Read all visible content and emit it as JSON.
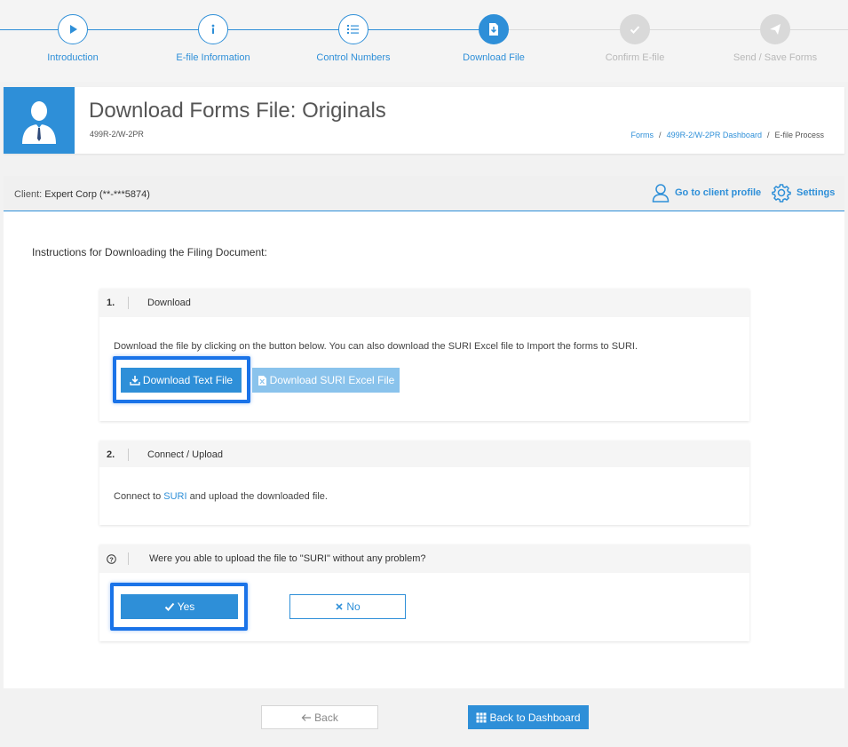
{
  "stepper": {
    "steps": [
      {
        "label": "Introduction",
        "icon": "play-icon",
        "state": "done"
      },
      {
        "label": "E-file Information",
        "icon": "info-icon",
        "state": "done"
      },
      {
        "label": "Control Numbers",
        "icon": "list-icon",
        "state": "done"
      },
      {
        "label": "Download File",
        "icon": "download-file-icon",
        "state": "current"
      },
      {
        "label": "Confirm E-file",
        "icon": "check-icon",
        "state": "todo"
      },
      {
        "label": "Send / Save Forms",
        "icon": "send-icon",
        "state": "todo"
      }
    ]
  },
  "header": {
    "title": "Download Forms File: Originals",
    "subtitle": "499R-2/W-2PR",
    "breadcrumb": [
      "Forms",
      "499R-2/W-2PR Dashboard",
      "E-file Process"
    ]
  },
  "clientbar": {
    "client_label": "Client:",
    "client_value": "Expert Corp (**-***5874)",
    "profile_link": "Go to client profile",
    "settings_link": "Settings"
  },
  "main": {
    "instructions": "Instructions for Downloading the Filing Document:",
    "step1": {
      "num": "1.",
      "title": "Download",
      "text": "Download the file by clicking on the button below. You can also download the SURI Excel file to Import the forms to SURI.",
      "btn_text_file": "Download Text File",
      "btn_excel_file": "Download SURI Excel File"
    },
    "step2": {
      "num": "2.",
      "title": "Connect / Upload",
      "text_before": "Connect to ",
      "link": "SURI",
      "text_after": " and upload the downloaded file."
    },
    "question": {
      "icon": "question-circle-icon",
      "text": "Were you able to upload the file to \"SURI\" without any problem?",
      "yes": "Yes",
      "no": "No"
    }
  },
  "footer": {
    "back": "Back",
    "back_to_dashboard": "Back to Dashboard"
  },
  "colors": {
    "accent": "#2e8fd8",
    "highlight": "#1a73e8",
    "inactive": "#d9d9d9"
  }
}
